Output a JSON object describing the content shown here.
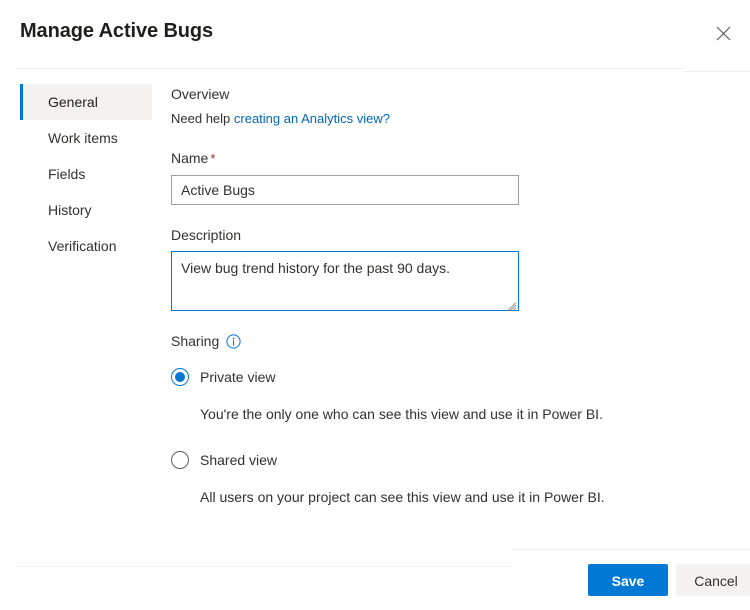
{
  "dialog": {
    "title": "Manage Active Bugs",
    "close_icon": "close-icon"
  },
  "sidebar": {
    "items": [
      {
        "label": "General",
        "selected": true
      },
      {
        "label": "Work items",
        "selected": false
      },
      {
        "label": "Fields",
        "selected": false
      },
      {
        "label": "History",
        "selected": false
      },
      {
        "label": "Verification",
        "selected": false
      }
    ]
  },
  "main": {
    "overview_heading": "Overview",
    "help_prefix": "Need help ",
    "help_link_text": "creating an Analytics view?",
    "name": {
      "label": "Name",
      "required_marker": "*",
      "value": "Active Bugs",
      "placeholder": ""
    },
    "description": {
      "label": "Description",
      "value": "View bug trend history for the past 90 days.",
      "placeholder": ""
    },
    "sharing": {
      "label": "Sharing",
      "info_icon": "info-icon",
      "options": [
        {
          "label": "Private view",
          "selected": true,
          "description": "You're the only one who can see this view and use it in Power BI."
        },
        {
          "label": "Shared view",
          "selected": false,
          "description": "All users on your project can see this view and use it in Power BI."
        }
      ]
    }
  },
  "footer": {
    "save_label": "Save",
    "cancel_label": "Cancel"
  },
  "colors": {
    "accent": "#0078d4",
    "link": "#0067b8",
    "required": "#a4262c",
    "selected_bg": "#f3f2f1",
    "divider": "#f0f0f0"
  }
}
